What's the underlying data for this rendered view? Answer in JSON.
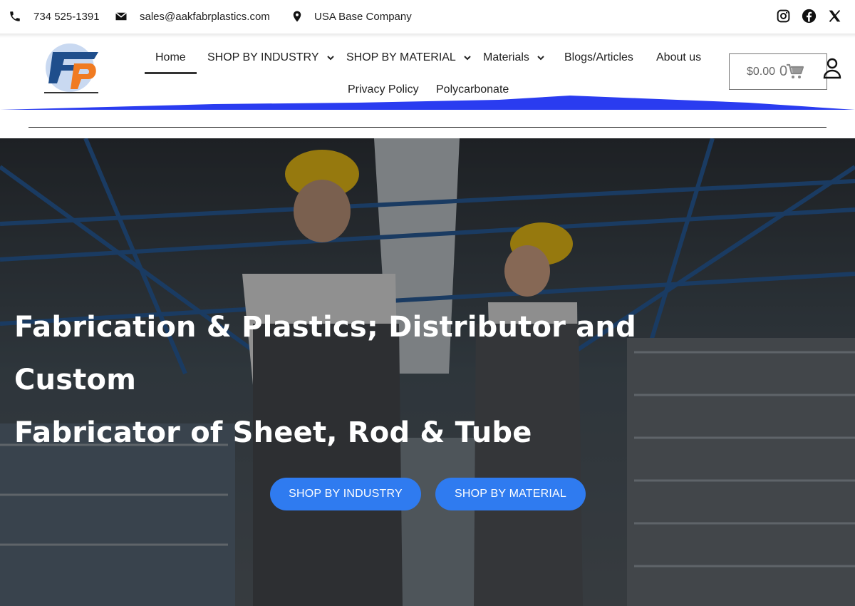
{
  "topbar": {
    "phone": "734 525-1391",
    "email": "sales@aakfabrplastics.com",
    "company": "USA Base Company",
    "phone_icon": "phone-icon",
    "email_icon": "envelope-icon",
    "location_icon": "map-pin-icon",
    "social": [
      "instagram-icon",
      "facebook-icon",
      "x-icon"
    ]
  },
  "nav": {
    "items": [
      {
        "label": "Home",
        "active": true
      },
      {
        "label": "SHOP BY INDUSTRY",
        "dropdown": true
      },
      {
        "label": "SHOP BY MATERIAL",
        "dropdown": true
      },
      {
        "label": "Materials",
        "dropdown": true
      },
      {
        "label": "Blogs/Articles"
      },
      {
        "label": "About us"
      },
      {
        "label": "Privacy Policy"
      },
      {
        "label": "Polycarbonate"
      }
    ]
  },
  "cart": {
    "total": "$0.00",
    "count": "0"
  },
  "hero": {
    "title_line1": "Fabrication & Plastics; Distributor and Custom",
    "title_line2": "Fabricator of Sheet, Rod & Tube",
    "btn_industry": "SHOP BY INDUSTRY",
    "btn_material": "SHOP BY MATERIAL"
  },
  "colors": {
    "accent": "#2f7bf0",
    "wave": "#2a3cf0",
    "logo_blue": "#1f4e8c",
    "logo_orange": "#f07b22"
  }
}
